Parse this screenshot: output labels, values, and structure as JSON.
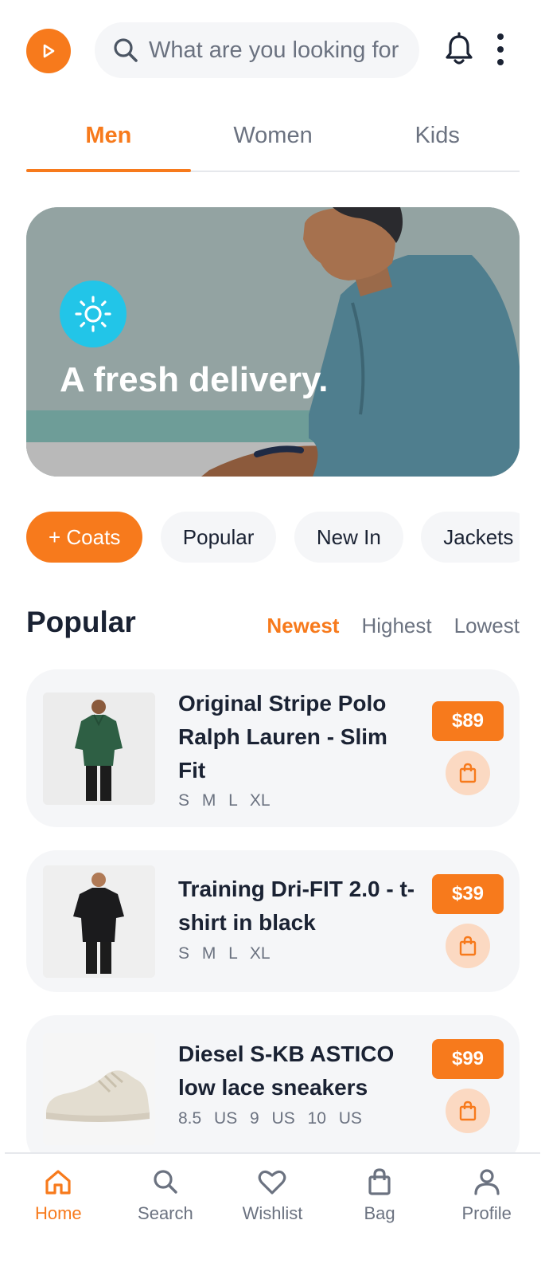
{
  "header": {
    "logo_icon": "play-icon",
    "search": {
      "placeholder": "What are you looking for",
      "icon": "search-icon"
    },
    "notification_icon": "bell-icon",
    "more_icon": "kebab-menu-icon"
  },
  "tabs": [
    {
      "label": "Men",
      "active": true
    },
    {
      "label": "Women",
      "active": false
    },
    {
      "label": "Kids",
      "active": false
    }
  ],
  "banner": {
    "icon": "sun-icon",
    "title": "A fresh delivery."
  },
  "chips": [
    {
      "label": "+ Coats",
      "active": true
    },
    {
      "label": "Popular",
      "active": false
    },
    {
      "label": "New In",
      "active": false
    },
    {
      "label": "Jackets",
      "active": false
    }
  ],
  "section": {
    "title": "Popular",
    "sort": [
      {
        "label": "Newest",
        "active": true
      },
      {
        "label": "Highest",
        "active": false
      },
      {
        "label": "Lowest",
        "active": false
      }
    ]
  },
  "products": [
    {
      "name": "Original Stripe Polo Ralph Lauren - Slim Fit",
      "sizes": "S M L XL",
      "price": "$89",
      "image": "green-polo-shirt"
    },
    {
      "name": "Training Dri-FIT 2.0 - t-shirt in black",
      "sizes": "S M L XL",
      "price": "$39",
      "image": "black-t-shirt"
    },
    {
      "name": "Diesel S-KB ASTICO low lace sneakers",
      "sizes": "8.5 US 9 US 10 US",
      "price": "$99",
      "image": "beige-sneaker"
    }
  ],
  "bottom_nav": [
    {
      "label": "Home",
      "icon": "home-icon",
      "active": true
    },
    {
      "label": "Search",
      "icon": "search-icon",
      "active": false
    },
    {
      "label": "Wishlist",
      "icon": "heart-icon",
      "active": false
    },
    {
      "label": "Bag",
      "icon": "bag-icon",
      "active": false
    },
    {
      "label": "Profile",
      "icon": "user-icon",
      "active": false
    }
  ],
  "colors": {
    "accent": "#f77a1c",
    "accent_light": "#fbd9c2",
    "text": "#1a2233",
    "muted": "#6b7280",
    "surface": "#f5f6f8",
    "banner_icon_bg": "#22c5e8"
  }
}
